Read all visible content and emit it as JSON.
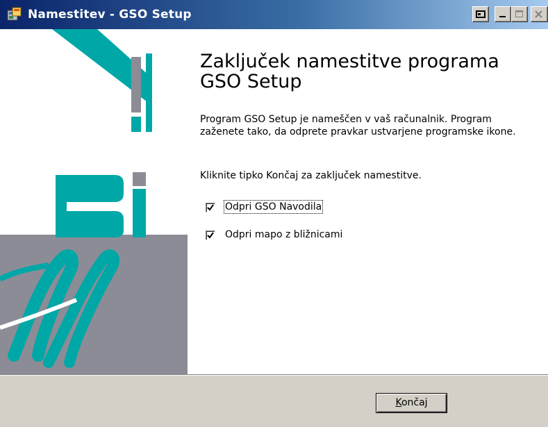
{
  "window": {
    "title": "Namestitev - GSO Setup"
  },
  "logo": {
    "text": "BiA",
    "colors": {
      "teal": "#00a7a7",
      "gray": "#8c8c96"
    }
  },
  "main": {
    "heading": "Zaključek namestitve programa GSO Setup",
    "paragraph": "Program GSO Setup je nameščen v vaš računalnik. Program zaženete tako, da odprete pravkar ustvarjene programske ikone.",
    "instruction": "Kliknite tipko Končaj za zaključek namestitve."
  },
  "options": [
    {
      "label": "Odpri GSO Navodila",
      "checked": true
    },
    {
      "label": "Odpri mapo z bližnicami",
      "checked": true
    }
  ],
  "footer": {
    "finish_label_underlined": "K",
    "finish_label_rest": "ončaj"
  }
}
